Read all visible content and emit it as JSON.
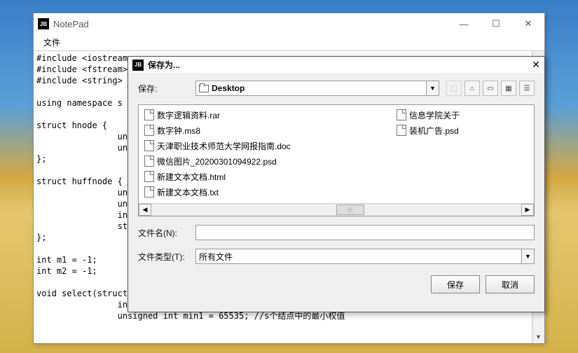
{
  "main": {
    "title": "NotePad",
    "menu_file": "文件",
    "code": "#include <iostream>\n#include <fstream>\n#include <string>\n\nusing namespace s\n\nstruct hnode {\n                uns\n                uns\n};\n\nstruct huffnode {\n                uns\n                uns\n                int p\n                stri\n};\n\nint m1 = -1;\nint m2 = -1;\n\nvoid select(struct hu\n                int i;\n                unsigned int min1 = 65535; //s个结点中的最小权值"
  },
  "dialog": {
    "title": "保存为...",
    "save_in_label": "保存:",
    "location": "Desktop",
    "filename_label": "文件名(N):",
    "filename_value": "",
    "filetype_label": "文件类型(T):",
    "filetype_value": "所有文件",
    "save_btn": "保存",
    "cancel_btn": "取消",
    "files": [
      "数字逻辑资料.rar",
      "数字钟.ms8",
      "天津职业技术师范大学网报指南.doc",
      "微信图片_20200301094922.psd",
      "新建文本文档.html",
      "新建文本文档.txt",
      "信息学院关于",
      "装机广告.psd"
    ]
  }
}
